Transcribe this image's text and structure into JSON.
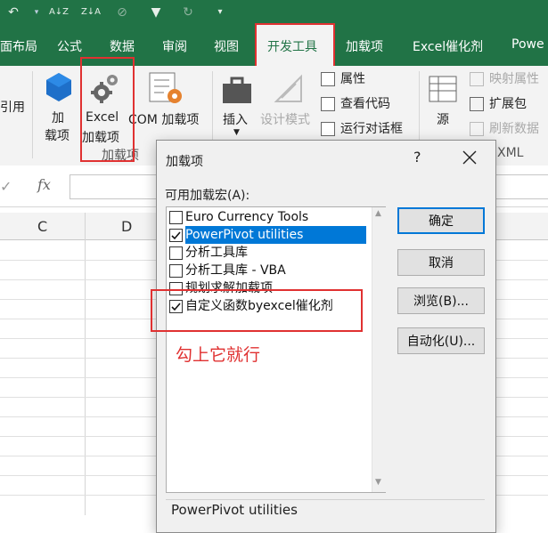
{
  "qat": {
    "undo": "↶",
    "sort_asc": "A↓Z",
    "sort_desc": "Z↓A",
    "clear_filter": "⊘",
    "filter": "▼",
    "reapply": "↻",
    "more": "▾"
  },
  "tabs": [
    "页面布局",
    "公式",
    "数据",
    "审阅",
    "视图",
    "开发工具",
    "加载项",
    "Excel催化剂",
    "Powe"
  ],
  "ribbon": {
    "addins_group_label": "加载项",
    "btn_addins_line1": "加",
    "btn_addins_line2": "载项",
    "btn_excel_addins_line1": "Excel",
    "btn_excel_addins_line2": "加载项",
    "btn_com_addins": "COM 加载项",
    "btn_insert": "插入",
    "btn_design_mode": "设计模式",
    "btn_properties": "属性",
    "btn_view_code": "查看代码",
    "btn_run_dialog": "运行对话框",
    "btn_source": "源",
    "btn_map_props": "映射属性",
    "btn_expansion": "扩展包",
    "btn_refresh_data": "刷新数据",
    "xml_group_label": "XML",
    "left_cut_label": "引用"
  },
  "formula_bar": {
    "check": "✓",
    "fx": "fx"
  },
  "grid": {
    "columns": [
      "C",
      "D"
    ]
  },
  "dialog": {
    "title": "加载项",
    "help": "?",
    "list_label": "可用加载宏(A):",
    "items": [
      {
        "label": "Euro Currency Tools",
        "checked": false,
        "selected": false
      },
      {
        "label": "PowerPivot utilities",
        "checked": true,
        "selected": true
      },
      {
        "label": "分析工具库",
        "checked": false,
        "selected": false
      },
      {
        "label": "分析工具库 - VBA",
        "checked": false,
        "selected": false
      },
      {
        "label": "规划求解加载项",
        "checked": false,
        "selected": false
      },
      {
        "label": "自定义函数byexcel催化剂",
        "checked": true,
        "selected": false
      }
    ],
    "buttons": {
      "ok": "确定",
      "cancel": "取消",
      "browse": "浏览(B)...",
      "automation": "自动化(U)..."
    },
    "description": "PowerPivot utilities"
  },
  "annotation": "勾上它就行",
  "colors": {
    "excel_green": "#217346",
    "highlight_red": "#e03131",
    "selection_blue": "#0078d7"
  }
}
